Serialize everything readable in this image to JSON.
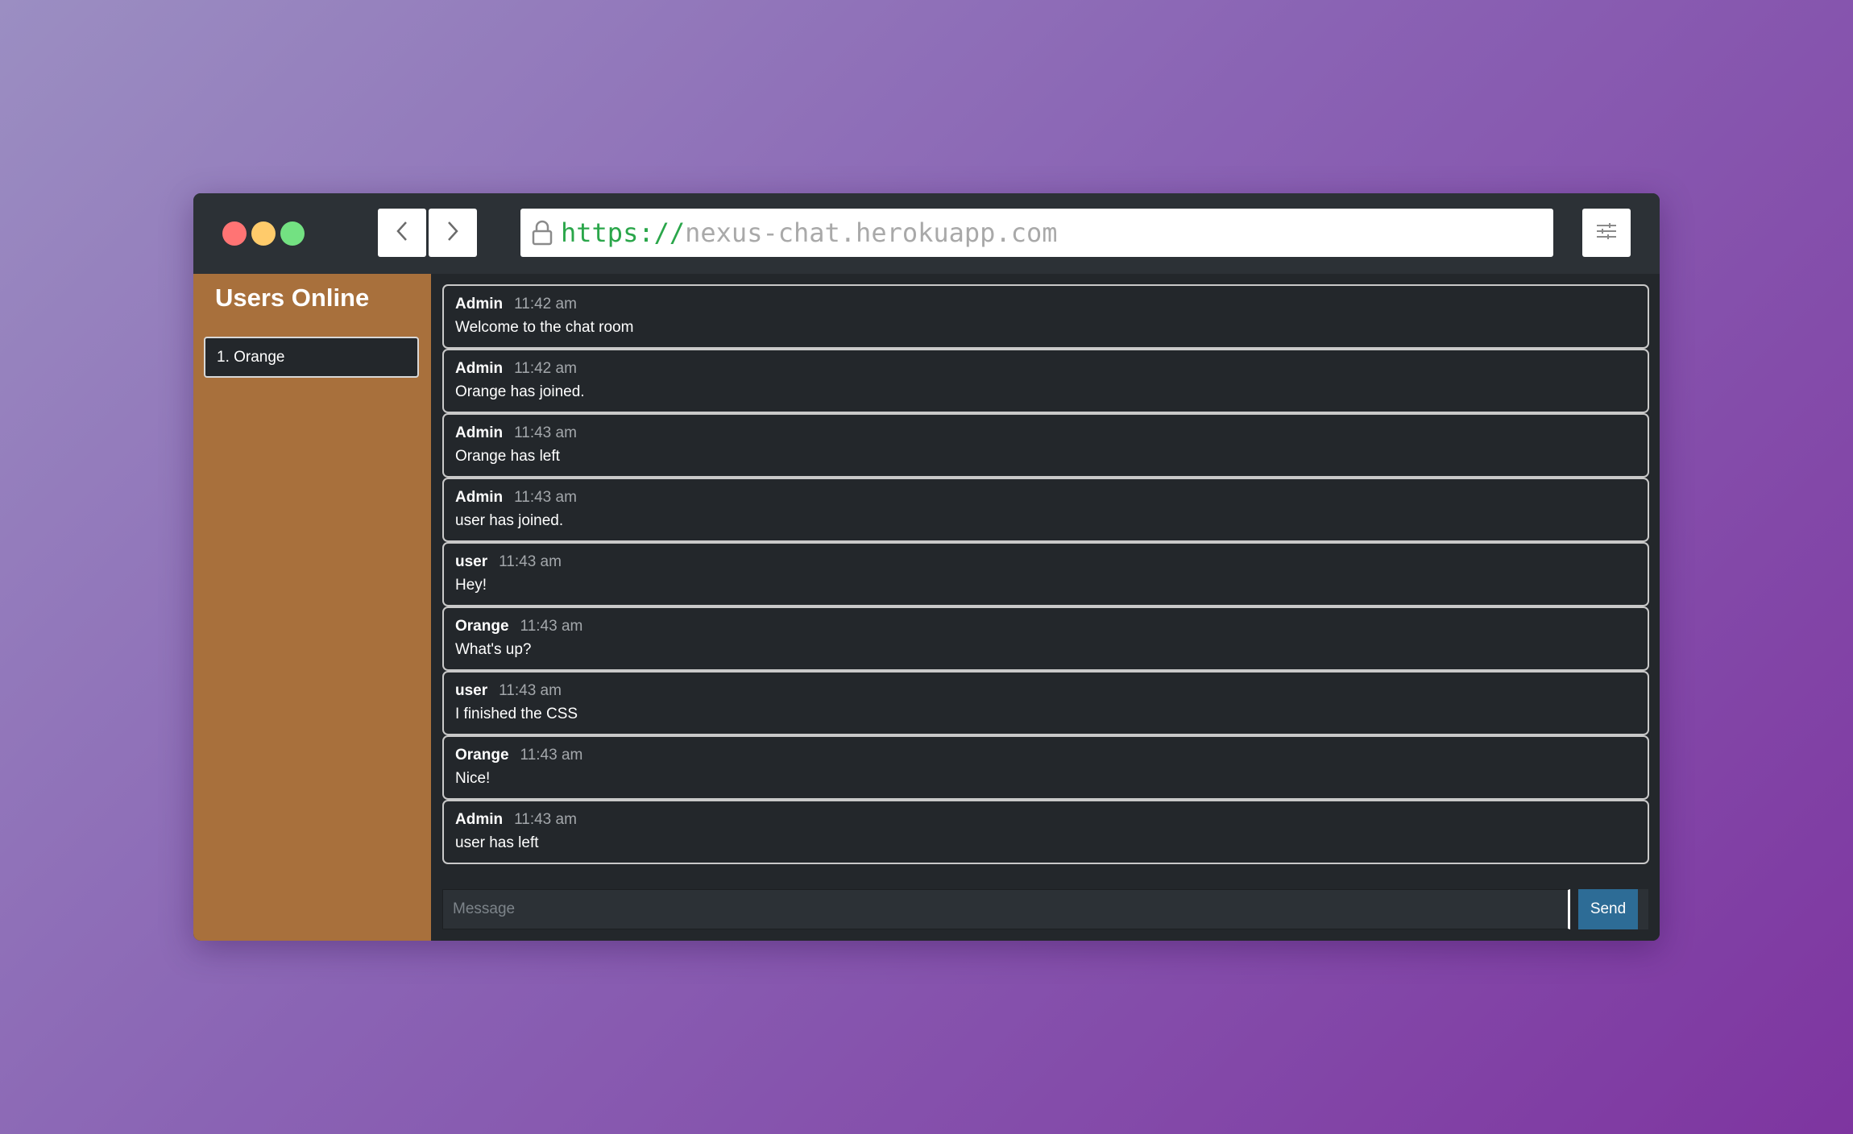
{
  "browser": {
    "url_protocol": "https://",
    "url_host": "nexus-chat.herokuapp.com",
    "window_dots": {
      "red": "#ff7474",
      "yellow": "#ffcb6b",
      "green": "#73e182"
    },
    "icons": {
      "back": "chevron-left-icon",
      "forward": "chevron-right-icon",
      "lock": "lock-icon",
      "settings": "sliders-icon"
    }
  },
  "sidebar": {
    "title": "Users Online",
    "users": [
      {
        "label": "1. Orange"
      }
    ]
  },
  "chat": {
    "messages": [
      {
        "author": "Admin",
        "time": "11:42 am",
        "text": "Welcome to the chat room"
      },
      {
        "author": "Admin",
        "time": "11:42 am",
        "text": "Orange has joined."
      },
      {
        "author": "Admin",
        "time": "11:43 am",
        "text": "Orange has left"
      },
      {
        "author": "Admin",
        "time": "11:43 am",
        "text": "user has joined."
      },
      {
        "author": "user",
        "time": "11:43 am",
        "text": "Hey!"
      },
      {
        "author": "Orange",
        "time": "11:43 am",
        "text": "What's up?"
      },
      {
        "author": "user",
        "time": "11:43 am",
        "text": "I finished the CSS"
      },
      {
        "author": "Orange",
        "time": "11:43 am",
        "text": "Nice!"
      },
      {
        "author": "Admin",
        "time": "11:43 am",
        "text": "user has left"
      }
    ],
    "composer": {
      "placeholder": "Message",
      "send_label": "Send"
    }
  },
  "colors": {
    "sidebar_bg": "#a8703c",
    "chat_bg": "#23272b",
    "send_button": "#2d6c96",
    "url_protocol": "#2aa64a"
  }
}
